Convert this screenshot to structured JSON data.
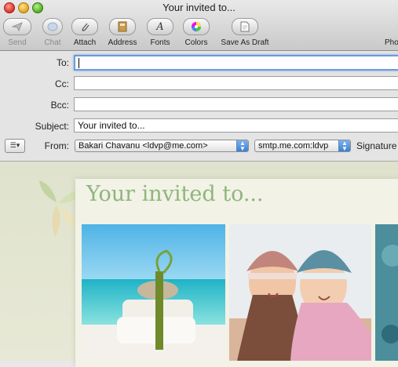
{
  "window": {
    "title": "Your invited to..."
  },
  "toolbar": {
    "items": [
      {
        "label": "Send",
        "icon": "paper-plane-icon"
      },
      {
        "label": "Chat",
        "icon": "chat-bubble-icon"
      },
      {
        "label": "Attach",
        "icon": "paperclip-icon"
      },
      {
        "label": "Address",
        "icon": "address-book-icon"
      },
      {
        "label": "Fonts",
        "icon": "fonts-icon"
      },
      {
        "label": "Colors",
        "icon": "color-wheel-icon"
      },
      {
        "label": "Save As Draft",
        "icon": "draft-icon"
      },
      {
        "label": "Pho",
        "icon": "photo-browser-icon"
      }
    ]
  },
  "fields": {
    "to": {
      "label": "To:",
      "value": ""
    },
    "cc": {
      "label": "Cc:",
      "value": ""
    },
    "bcc": {
      "label": "Bcc:",
      "value": ""
    },
    "subject": {
      "label": "Subject:",
      "value": "Your invited to..."
    },
    "from": {
      "label": "From:",
      "value": "Bakari Chavanu <ldvp@me.com>"
    },
    "smtp": {
      "value": "smtp.me.com:ldvp"
    },
    "signature": {
      "label": "Signature"
    }
  },
  "stationery": {
    "heading": "Your invited to...",
    "heading_color": "#8fb57c"
  }
}
